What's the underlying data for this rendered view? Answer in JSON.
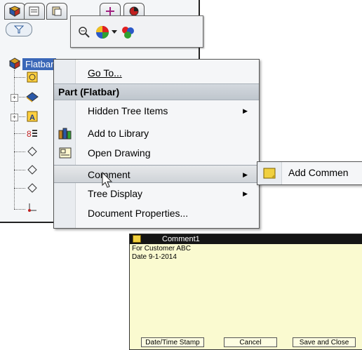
{
  "feature_manager": {
    "root_label": "Flatbar",
    "filter_icon": "filter-icon",
    "tabs": [
      "feature-manager-tab",
      "property-manager-tab",
      "configuration-manager-tab",
      "dimxpert-tab",
      "display-manager-tab"
    ]
  },
  "icon_toolbar": {
    "icons": [
      "zoom-to-selection-icon",
      "appearance-icon",
      "dropdown-arrow-icon",
      "color-scheme-icon"
    ]
  },
  "context_menu": {
    "go_to": "Go To...",
    "header": "Part (Flatbar)",
    "items": [
      {
        "label": "Hidden Tree Items",
        "submenu": true
      },
      {
        "label": "Add to Library",
        "submenu": false
      },
      {
        "label": "Open Drawing",
        "submenu": false
      },
      {
        "label": "Comment",
        "submenu": true
      },
      {
        "label": "Tree Display",
        "submenu": true
      },
      {
        "label": "Document Properties...",
        "submenu": false
      }
    ]
  },
  "submenu": {
    "add_comment": "Add Commen"
  },
  "comment_window": {
    "title": "Comment1",
    "line1": "For Customer ABC",
    "line2": "Date 9-1-2014",
    "buttons": {
      "date_time": "Date/Time Stamp",
      "cancel": "Cancel",
      "save_close": "Save and Close"
    },
    "background": "#fafad0"
  },
  "colors": {
    "selection": "#3a67b8",
    "titlebar": "#151515"
  }
}
